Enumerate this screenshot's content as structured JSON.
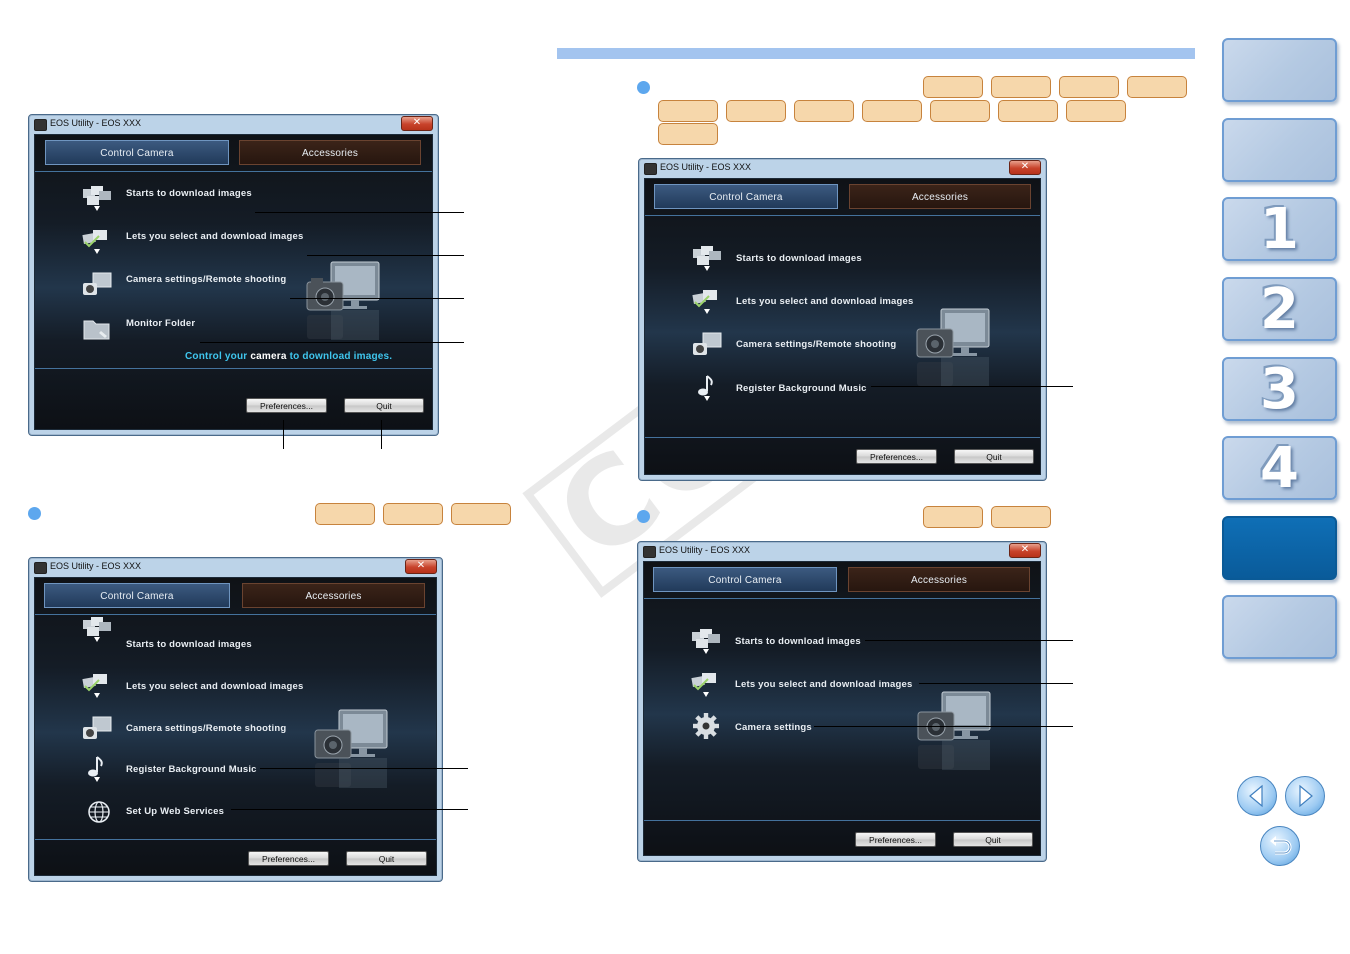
{
  "colors": {
    "accent_bar": "#a3c4ef",
    "bullet": "#5da7ee",
    "badge_fill": "#f6d7ab",
    "badge_border": "#c7833d",
    "nav_active": "#0f6fb6",
    "control_text": "#3fc6ee"
  },
  "watermark": "COPY",
  "windows": [
    {
      "title": "EOS Utility -  EOS XXX",
      "tab_control": "Control Camera",
      "tab_accessories": "Accessories",
      "items": [
        {
          "label": "Starts to download images",
          "icon": "download-images-icon"
        },
        {
          "label": "Lets you select and download images",
          "icon": "select-download-icon"
        },
        {
          "label": "Camera settings/Remote shooting",
          "icon": "camera-monitor-icon"
        },
        {
          "label": "Monitor Folder",
          "icon": "monitor-folder-icon"
        }
      ],
      "footer_text_parts": [
        "Control your ",
        "camera",
        " to download images."
      ],
      "preferences": "Preferences...",
      "quit": "Quit"
    },
    {
      "title": "EOS Utility -  EOS XXX",
      "tab_control": "Control Camera",
      "tab_accessories": "Accessories",
      "items": [
        {
          "label": "Starts to download images",
          "icon": "download-images-icon"
        },
        {
          "label": "Lets you select and download images",
          "icon": "select-download-icon"
        },
        {
          "label": "Camera settings/Remote shooting",
          "icon": "camera-monitor-icon"
        },
        {
          "label": "Register Background Music",
          "icon": "music-note-icon"
        },
        {
          "label": "Set Up Web Services",
          "icon": "globe-icon"
        }
      ],
      "preferences": "Preferences...",
      "quit": "Quit"
    },
    {
      "title": "EOS Utility -  EOS XXX",
      "tab_control": "Control Camera",
      "tab_accessories": "Accessories",
      "items": [
        {
          "label": "Starts to download images",
          "icon": "download-images-icon"
        },
        {
          "label": "Lets you select and download images",
          "icon": "select-download-icon"
        },
        {
          "label": "Camera settings/Remote shooting",
          "icon": "camera-monitor-icon"
        },
        {
          "label": "Register Background Music",
          "icon": "music-note-icon"
        }
      ],
      "preferences": "Preferences...",
      "quit": "Quit"
    },
    {
      "title": "EOS Utility -  EOS XXX",
      "tab_control": "Control Camera",
      "tab_accessories": "Accessories",
      "items": [
        {
          "label": "Starts to download images",
          "icon": "download-images-icon"
        },
        {
          "label": "Lets you select and download images",
          "icon": "select-download-icon"
        },
        {
          "label": "Camera settings",
          "icon": "gear-icon"
        }
      ],
      "preferences": "Preferences...",
      "quit": "Quit"
    }
  ],
  "nav": {
    "buttons": [
      {
        "label": "",
        "name": "nav-button-top"
      },
      {
        "label": "",
        "name": "nav-button-contents"
      },
      {
        "label": "1",
        "name": "nav-button-chapter-1"
      },
      {
        "label": "2",
        "name": "nav-button-chapter-2"
      },
      {
        "label": "3",
        "name": "nav-button-chapter-3"
      },
      {
        "label": "4",
        "name": "nav-button-chapter-4"
      },
      {
        "label": "",
        "name": "nav-button-current-section"
      },
      {
        "label": "",
        "name": "nav-button-index"
      }
    ],
    "prev_icon": "left-arrow-icon",
    "next_icon": "right-arrow-icon",
    "return_icon": "return-arrow-icon"
  }
}
